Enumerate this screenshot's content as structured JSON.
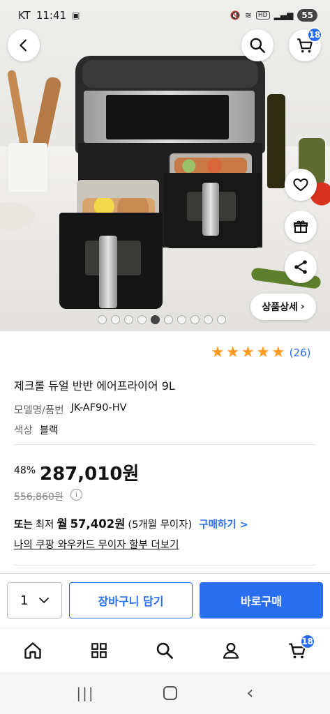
{
  "status_bar": {
    "carrier": "KT",
    "time": "11:41",
    "battery": "55"
  },
  "header": {
    "cart_count": "18"
  },
  "gallery": {
    "detail_label": "상품상세",
    "total_images": 10,
    "active_index": 5
  },
  "rating": {
    "stars": 5,
    "count": "(26)"
  },
  "product": {
    "title": "제크롤 듀얼 반반 에어프라이어 9L",
    "model_label": "모델명/품번",
    "model_value": "JK-AF90-HV",
    "color_label": "색상",
    "color_value": "블랙"
  },
  "price": {
    "discount": "48%",
    "sale_price": "287,010원",
    "original_price": "556,860원",
    "installment_prefix": "또는",
    "installment_min": "최저",
    "installment_month": "월",
    "installment_amount": "57,402원",
    "installment_terms": "(5개월 무이자)",
    "installment_link": "구매하기 >",
    "card_link": "나의 쿠팡 와우카드 무이자 할부 더보기"
  },
  "purchase_bar": {
    "quantity": "1",
    "cart_button": "장바구니 담기",
    "buy_button": "바로구매"
  },
  "bottom_nav": {
    "cart_count": "18"
  },
  "colors": {
    "accent": "#2a6ef0",
    "star": "#ff9b21"
  }
}
